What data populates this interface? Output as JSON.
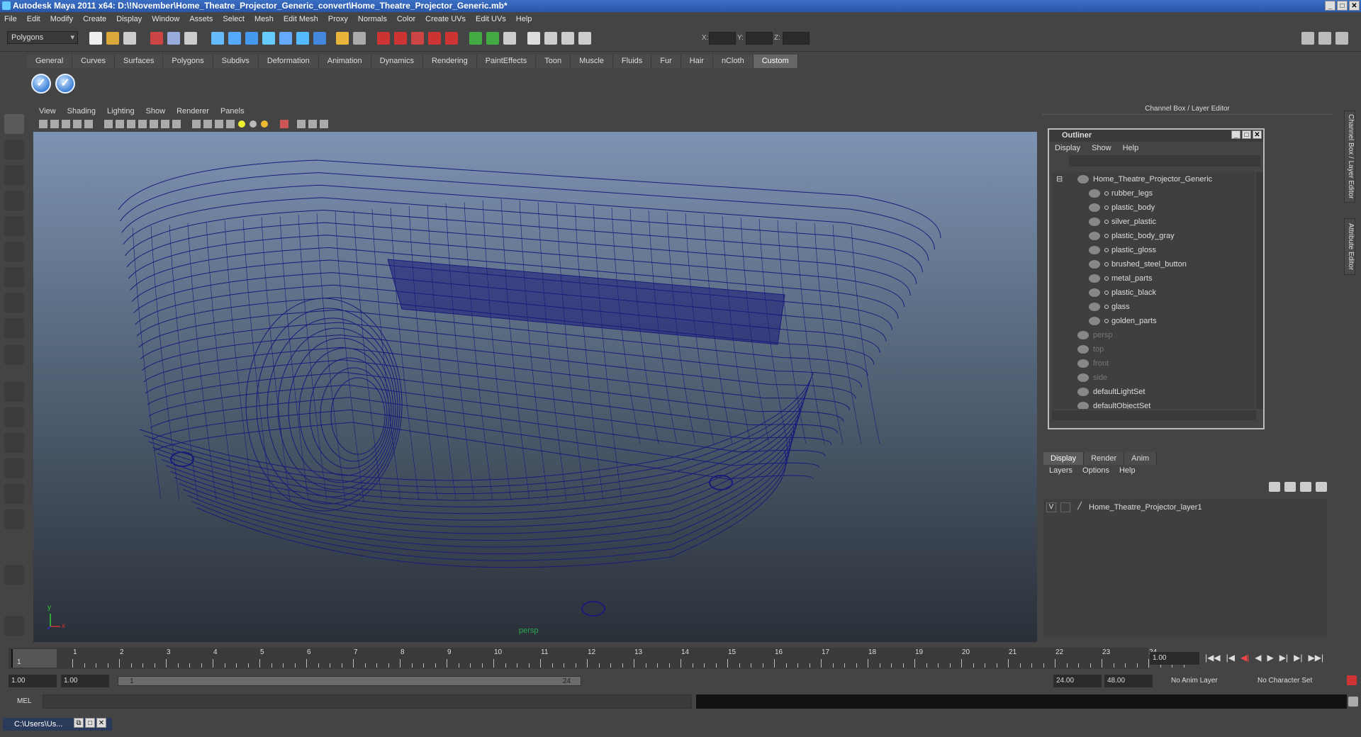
{
  "window": {
    "title": "Autodesk Maya 2011 x64: D:\\!November\\Home_Theatre_Projector_Generic_convert\\Home_Theatre_Projector_Generic.mb*"
  },
  "menubar": [
    "File",
    "Edit",
    "Modify",
    "Create",
    "Display",
    "Window",
    "Assets",
    "Select",
    "Mesh",
    "Edit Mesh",
    "Proxy",
    "Normals",
    "Color",
    "Create UVs",
    "Edit UVs",
    "Help"
  ],
  "statusline": {
    "mode": "Polygons",
    "x_label": "X:",
    "y_label": "Y:",
    "z_label": "Z:"
  },
  "shelf": {
    "tabs": [
      "General",
      "Curves",
      "Surfaces",
      "Polygons",
      "Subdivs",
      "Deformation",
      "Animation",
      "Dynamics",
      "Rendering",
      "PaintEffects",
      "Toon",
      "Muscle",
      "Fluids",
      "Fur",
      "Hair",
      "nCloth",
      "Custom"
    ],
    "active": "Custom"
  },
  "viewport": {
    "menu": [
      "View",
      "Shading",
      "Lighting",
      "Show",
      "Renderer",
      "Panels"
    ],
    "camera_label": "persp",
    "axis_x": "x",
    "axis_y": "y",
    "wire_color": "#1a1a7a"
  },
  "channelbox": {
    "title": "Channel Box / Layer Editor"
  },
  "side_tabs": [
    "Channel Box / Layer Editor",
    "Attribute Editor"
  ],
  "outliner": {
    "title": "Outliner",
    "menu": [
      "Display",
      "Show",
      "Help"
    ],
    "items": [
      {
        "label": "Home_Theatre_Projector_Generic",
        "level": 0,
        "dim": false
      },
      {
        "label": "rubber_legs",
        "level": 1,
        "dim": false
      },
      {
        "label": "plastic_body",
        "level": 1,
        "dim": false
      },
      {
        "label": "silver_plastic",
        "level": 1,
        "dim": false
      },
      {
        "label": "plastic_body_gray",
        "level": 1,
        "dim": false
      },
      {
        "label": "plastic_gloss",
        "level": 1,
        "dim": false
      },
      {
        "label": "brushed_steel_button",
        "level": 1,
        "dim": false
      },
      {
        "label": "metal_parts",
        "level": 1,
        "dim": false
      },
      {
        "label": "plastic_black",
        "level": 1,
        "dim": false
      },
      {
        "label": "glass",
        "level": 1,
        "dim": false
      },
      {
        "label": "golden_parts",
        "level": 1,
        "dim": false
      },
      {
        "label": "persp",
        "level": 0,
        "dim": true
      },
      {
        "label": "top",
        "level": 0,
        "dim": true
      },
      {
        "label": "front",
        "level": 0,
        "dim": true
      },
      {
        "label": "side",
        "level": 0,
        "dim": true
      },
      {
        "label": "defaultLightSet",
        "level": 0,
        "dim": false
      },
      {
        "label": "defaultObjectSet",
        "level": 0,
        "dim": false
      }
    ]
  },
  "layer_editor": {
    "tabs": [
      "Display",
      "Render",
      "Anim"
    ],
    "active": "Display",
    "menu": [
      "Layers",
      "Options",
      "Help"
    ],
    "layer_visible": "V",
    "layer_name": "Home_Theatre_Projector_layer1"
  },
  "timeslider": {
    "ticks": [
      "1",
      "2",
      "3",
      "4",
      "5",
      "6",
      "7",
      "8",
      "9",
      "10",
      "11",
      "12",
      "13",
      "14",
      "15",
      "16",
      "17",
      "18",
      "19",
      "20",
      "21",
      "22",
      "23",
      "24"
    ],
    "current_marker": "1",
    "current_frame": "1.00"
  },
  "playback_icons": [
    "|◀◀",
    "|◀",
    "◀|",
    "◀",
    "▶",
    "▶|",
    "▶|",
    "▶▶|"
  ],
  "rangeslider": {
    "start": "1.00",
    "anim_start": "1.00",
    "range_left": "1",
    "range_right": "24",
    "range_end": "24.00",
    "anim_end": "48.00",
    "anim_layer": "No Anim Layer",
    "char_set": "No Character Set"
  },
  "cmdline": {
    "label": "MEL"
  },
  "taskbar": {
    "item": "C:\\Users\\Us..."
  }
}
